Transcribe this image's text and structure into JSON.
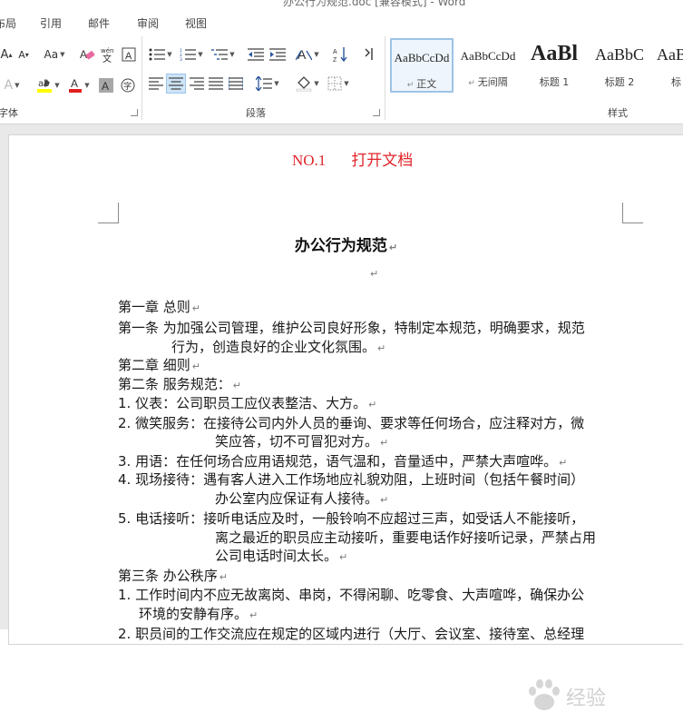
{
  "window": {
    "title": "办公行为规范.doc [兼容模式] - Word"
  },
  "tabs": [
    "布局",
    "引用",
    "邮件",
    "审阅",
    "视图"
  ],
  "ribbon": {
    "font_group_label": "字体",
    "paragraph_group_label": "段落",
    "styles_group_label": "样式",
    "font_case_label": "Aa",
    "styles": [
      {
        "sample": "AaBbCcDd",
        "name": "正文",
        "selected": true
      },
      {
        "sample": "AaBbCcDd",
        "name": "无间隔",
        "selected": false
      },
      {
        "sample": "AaBl",
        "name": "标题 1",
        "selected": false
      },
      {
        "sample": "AaBbC",
        "name": "标题 2",
        "selected": false
      },
      {
        "sample": "AaB",
        "name": "标",
        "selected": false
      }
    ],
    "colors": {
      "highlight": "#ffff00",
      "font_color": "#e02020",
      "accent": "#2b579a"
    }
  },
  "annotation": {
    "step": "NO.1",
    "text": "打开文档",
    "color": "#e0262a"
  },
  "document": {
    "title": "办公行为规范",
    "lines": [
      "第一章  总则",
      "第一条  为加强公司管理，维护公司良好形象，特制定本规范，明确要求，规范",
      "行为，创造良好的企业文化氛围。",
      "第二章  细则",
      "第二条  服务规范：",
      "1. 仪表：公司职员工应仪表整洁、大方。",
      "2. 微笑服务：在接待公司内外人员的垂询、要求等任何场合，应注释对方，微",
      "笑应答，切不可冒犯对方。",
      "3. 用语：在任何场合应用语规范，语气温和，音量适中，严禁大声喧哗。",
      "4. 现场接待：遇有客人进入工作场地应礼貌劝阻，上班时间（包括午餐时间）",
      "办公室内应保证有人接待。",
      "5. 电话接听：接听电话应及时，一般铃响不应超过三声，如受话人不能接听，",
      "离之最近的职员应主动接听，重要电话作好接听记录，严禁占用",
      "公司电话时间太长。",
      "第三条  办公秩序",
      "1. 工作时间内不应无故离岗、串岗，不得闲聊、吃零食、大声喧哗，确保办公",
      "环境的安静有序。",
      "2. 职员间的工作交流应在规定的区域内进行（大厅、会议室、接待室、总经理"
    ]
  },
  "watermark": {
    "text": "经验"
  }
}
